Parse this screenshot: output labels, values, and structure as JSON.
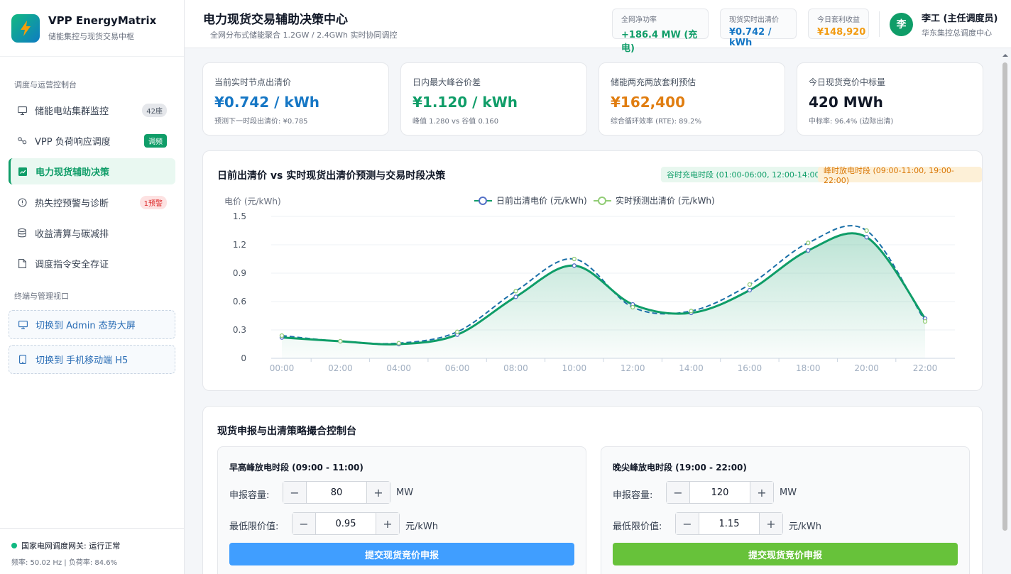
{
  "sidebar": {
    "app_name": "VPP EnergyMatrix",
    "app_sub": "储能集控与现货交易中枢",
    "section1": "调度与运营控制台",
    "items": [
      {
        "label": "储能电站集群监控",
        "badge": "42座"
      },
      {
        "label": "VPP 负荷响应调度",
        "badge": "调频"
      },
      {
        "label": "电力现货辅助决策",
        "badge": ""
      },
      {
        "label": "热失控预警与诊断",
        "badge": "1预警"
      },
      {
        "label": "收益清算与碳减排",
        "badge": ""
      },
      {
        "label": "调度指令安全存证",
        "badge": ""
      }
    ],
    "section2": "终端与管理视口",
    "switch_admin": "切换到 Admin 态势大屏",
    "switch_mobile": "切换到 手机移动端 H5",
    "footer_status": "国家电网调度网关: 运行正常",
    "footer_metrics": "频率: 50.02 Hz | 负荷率: 84.6%"
  },
  "header": {
    "title": "电力现货交易辅助决策中心",
    "subtitle": "全网分布式储能聚合 1.2GW / 2.4GWh 实时协同调控",
    "kpis": [
      {
        "label": "全网净功率",
        "value": "+186.4 MW (充电)",
        "color": "#0f9d68"
      },
      {
        "label": "现货实时出清价",
        "value": "¥0.742 / kWh",
        "color": "#1677c5"
      },
      {
        "label": "今日套利收益",
        "value": "¥148,920",
        "color": "#f29b11"
      }
    ],
    "user_name": "李工 (主任调度员)",
    "user_org": "华东集控总调度中心",
    "avatar_char": "李"
  },
  "stats": [
    {
      "label": "当前实时节点出清价",
      "value": "¥0.742 / kWh",
      "sub": "预测下一时段出清价: ¥0.785",
      "color": "#1677c5"
    },
    {
      "label": "日内最大峰谷价差",
      "value": "¥1.120 / kWh",
      "sub": "峰值 1.280 vs 谷值 0.160",
      "color": "#0f9d68"
    },
    {
      "label": "储能两充两放套利预估",
      "value": "¥162,400",
      "sub": "综合循环效率 (RTE): 89.2%",
      "color": "#e07d10"
    },
    {
      "label": "今日现货竞价中标量",
      "value": "420 MWh",
      "sub": "中标率: 96.4% (边际出清)",
      "color": "#111827"
    }
  ],
  "chart_card": {
    "title": "日前出清价 vs 实时现货出清价预测与交易时段决策",
    "tag_valley": "谷时充电时段 (01:00-06:00, 12:00-14:00)",
    "tag_peak": "峰时放电时段 (09:00-11:00, 19:00-22:00)"
  },
  "chart_data": {
    "type": "line",
    "ylabel": "电价 (元/kWh)",
    "ylim": [
      0,
      1.5
    ],
    "yticks": [
      "0",
      "0.3",
      "0.6",
      "0.9",
      "1.2",
      "1.5"
    ],
    "x": [
      "00:00",
      "02:00",
      "04:00",
      "06:00",
      "08:00",
      "10:00",
      "12:00",
      "14:00",
      "16:00",
      "18:00",
      "20:00",
      "22:00"
    ],
    "series": [
      {
        "name": "日前出清电价 (元/kWh)",
        "values": [
          0.22,
          0.18,
          0.15,
          0.25,
          0.65,
          0.98,
          0.57,
          0.48,
          0.72,
          1.14,
          1.28,
          0.42
        ],
        "color": "#0f9d68",
        "marker": "#5470c6"
      },
      {
        "name": "实时预测出清价 (元/kWh)",
        "values": [
          0.24,
          0.18,
          0.16,
          0.28,
          0.71,
          1.05,
          0.54,
          0.5,
          0.78,
          1.22,
          1.35,
          0.39
        ],
        "color": "#1a6fa8",
        "marker": "#91cc75"
      }
    ],
    "grid": true,
    "legend": "top-center"
  },
  "control": {
    "title": "现货申报与出清策略撮合控制台",
    "panels": [
      {
        "title": "早高峰放电时段 (09:00 - 11:00)",
        "cap_label": "申报容量:",
        "cap_value": "80",
        "cap_unit": "MW",
        "price_label": "最低限价值:",
        "price_value": "0.95",
        "price_unit": "元/kWh",
        "submit": "提交现货竞价申报",
        "color": "#409eff"
      },
      {
        "title": "晚尖峰放电时段 (19:00 - 22:00)",
        "cap_label": "申报容量:",
        "cap_value": "120",
        "cap_unit": "MW",
        "price_label": "最低限价值:",
        "price_value": "1.15",
        "price_unit": "元/kWh",
        "submit": "提交现货竞价申报",
        "color": "#67c23a"
      }
    ],
    "minus": "−",
    "plus": "+"
  }
}
